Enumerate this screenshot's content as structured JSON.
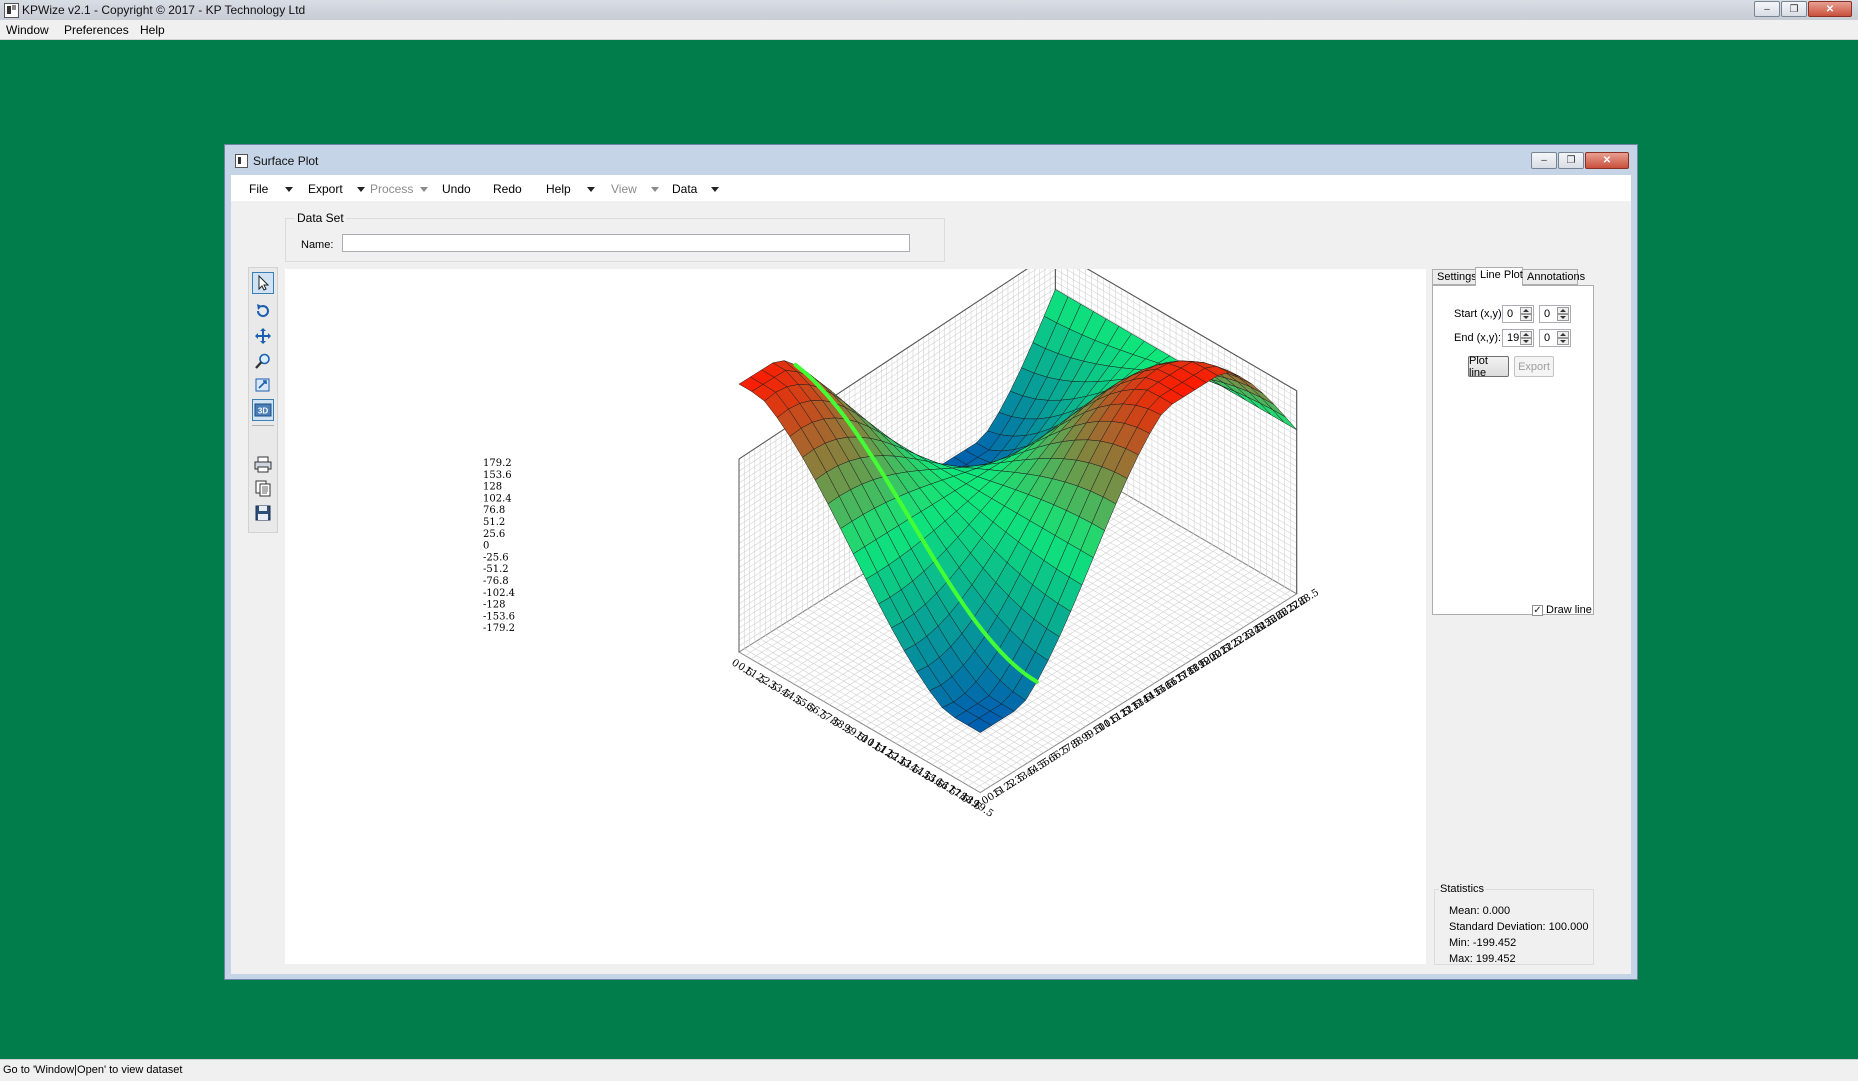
{
  "app": {
    "title": "KPWize v2.1 - Copyright © 2017 - KP Technology Ltd",
    "menu": [
      "Window",
      "Preferences",
      "Help"
    ],
    "status": "Go to 'Window|Open' to view dataset",
    "window_controls": {
      "minimize": "–",
      "restore": "❐",
      "close": "✕"
    }
  },
  "child_window": {
    "title": "Surface Plot",
    "menu": {
      "file": "File",
      "export": "Export",
      "process": "Process",
      "undo": "Undo",
      "redo": "Redo",
      "help": "Help",
      "view": "View",
      "data": "Data"
    },
    "dataset": {
      "legend": "Data Set",
      "name_label": "Name:",
      "name_value": ""
    },
    "tools": [
      "pointer-icon",
      "rotate-icon",
      "pan-icon",
      "zoom-icon",
      "zoom-box-icon",
      "3d-view-icon",
      "print-icon",
      "copy-icon",
      "save-icon"
    ],
    "tabs": [
      "Settings",
      "Line Plot",
      "Annotations"
    ],
    "selected_tab": "Line Plot",
    "line_plot": {
      "start_label": "Start (x,y):",
      "start_x": "0",
      "start_y": "0",
      "end_label": "End (x,y):",
      "end_x": "19",
      "end_y": "0",
      "plot_button": "Plot line",
      "export_button": "Export",
      "draw_line_label": "Draw line",
      "draw_line_checked": true
    },
    "statistics": {
      "legend": "Statistics",
      "mean": "Mean: 0.000",
      "std": "Standard Deviation: 100.000",
      "min": "Min: -199.452",
      "max": "Max: 199.452"
    }
  },
  "chart_data": {
    "type": "surface",
    "z_ticks": [
      "179.2",
      "153.6",
      "128",
      "102.4",
      "76.8",
      "51.2",
      "25.6",
      "0",
      "-25.6",
      "-51.2",
      "-76.8",
      "-102.4",
      "-128",
      "-153.6",
      "-179.2"
    ],
    "x_ticks": [
      "0",
      "0.5",
      "1",
      "1.5",
      "2",
      "2.5",
      "3",
      "3.5",
      "4",
      "4.5",
      "5",
      "5.5",
      "6",
      "6.5",
      "7",
      "7.5",
      "8",
      "8.5",
      "9",
      "9.5",
      "10",
      "10.5",
      "11",
      "11.5",
      "12",
      "12.5",
      "13",
      "13.5",
      "14",
      "14.5",
      "15",
      "15.5",
      "16",
      "16.5",
      "17",
      "17.5",
      "18",
      "18.5",
      "19",
      "19.5"
    ],
    "y_ticks": [
      "0",
      "0.5",
      "1",
      "1.5",
      "2",
      "2.5",
      "3",
      "3.5",
      "4",
      "4.5",
      "5",
      "5.5",
      "6",
      "6.5",
      "7",
      "7.5",
      "8",
      "8.5",
      "9",
      "9.5",
      "10",
      "10.5",
      "11",
      "11.5",
      "12",
      "12.5",
      "13",
      "13.5",
      "14",
      "14.5",
      "15",
      "15.5",
      "16",
      "16.5",
      "17",
      "17.5",
      "18",
      "18.5",
      "19",
      "19.5",
      "20",
      "20.5",
      "21",
      "21.5",
      "22",
      "22.5",
      "23",
      "23.5",
      "24",
      "24.5",
      "25",
      "25.5",
      "26",
      "26.5",
      "27",
      "27.5",
      "28",
      "28.5"
    ],
    "x_range": [
      0,
      19
    ],
    "y_range": [
      0,
      28
    ],
    "z_range": [
      -199.452,
      199.452
    ],
    "grid_nx": 20,
    "grid_ny": 29,
    "colors": {
      "high": "#ff1a00",
      "mid": "#10e87a",
      "low": "#005fb0",
      "line": "#44ff33"
    },
    "line_plot": {
      "start": [
        0,
        0
      ],
      "end": [
        19,
        0
      ]
    }
  }
}
